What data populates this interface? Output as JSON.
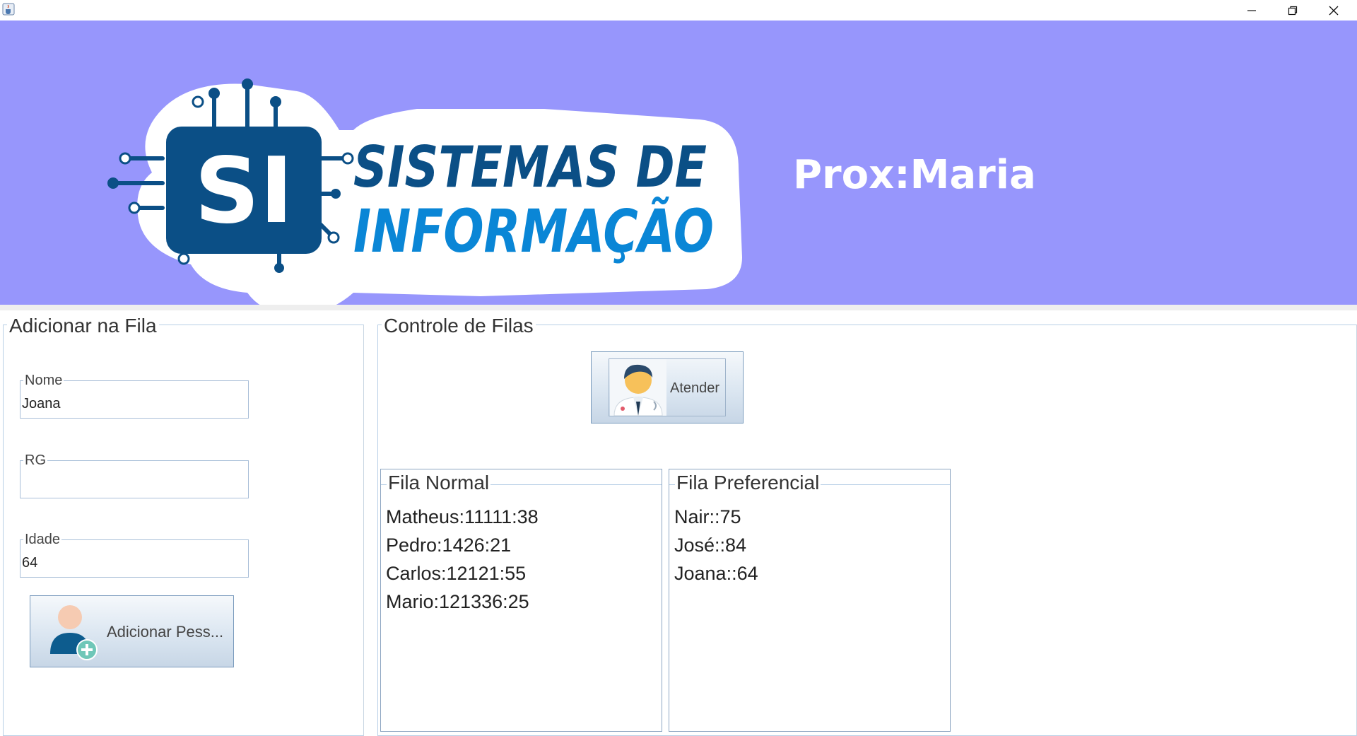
{
  "window": {
    "icon": "java-cup-icon",
    "controls": [
      "minimize-icon",
      "restore-icon",
      "close-icon"
    ]
  },
  "banner": {
    "logo_badge": "SI",
    "logo_line1": "SISTEMAS DE",
    "logo_line2": "INFORMAÇÃO",
    "next_label": "Prox:Maria",
    "background": "#9796fc"
  },
  "add_panel": {
    "title": "Adicionar na Fila",
    "fields": {
      "nome": {
        "label": "Nome",
        "value": "Joana"
      },
      "rg": {
        "label": "RG",
        "value": ""
      },
      "idade": {
        "label": "Idade",
        "value": "64"
      }
    },
    "add_button": {
      "label": "Adicionar Pess...",
      "icon": "add-person-icon"
    }
  },
  "control_panel": {
    "title": "Controle de Filas",
    "attend_button": {
      "label": "Atender",
      "icon": "doctor-icon"
    },
    "normal_queue": {
      "title": "Fila Normal",
      "items": [
        "Matheus:11111:38",
        "Pedro:1426:21",
        "Carlos:12121:55",
        "Mario:121336:25"
      ]
    },
    "preferential_queue": {
      "title": "Fila Preferencial",
      "items": [
        "Nair::75",
        "José::84",
        "Joana::64"
      ]
    }
  }
}
